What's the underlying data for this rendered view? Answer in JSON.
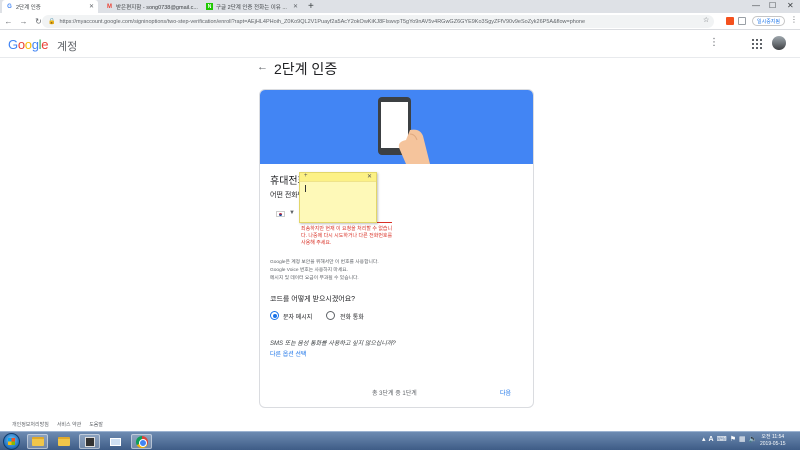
{
  "browser": {
    "tabs": [
      {
        "title": "2단계 인증",
        "favicon": "google-g",
        "active": true
      },
      {
        "title": "받은편지함 - song0738@gmail.c...",
        "favicon": "gmail-m",
        "active": false
      },
      {
        "title": "구글 2단계 인증 전화는 이유 ...",
        "favicon": "green-square",
        "active": false
      }
    ],
    "url": "https://myaccount.google.com/signinoptions/two-step-verification/enroll?rapt=AEjHL4PHoih_Z0Ko9QL2V1Puayf2a5AcY2okOwKiKJ8FIswvpT5gYo9nAV5v4RGwGZ6GYE9Ko3SgyZFfV90v9eSoZyk26P5A&flow=phone",
    "paused_label": "일시중지됨"
  },
  "header": {
    "logo": "Google",
    "account_label": "계정"
  },
  "page": {
    "title": "2단계 인증"
  },
  "card": {
    "title": "휴대전화",
    "subtitle": "어떤 전화번",
    "error": "죄송하지만 현재 이 요청을 처리할 수 없습니다. 나중에 다시 시도하거나 다른 전화번호를 사용해 주세요.",
    "info_lines": [
      "Google은 계정 보안을 위해서만 이 번호를 사용합니다.",
      "Google Voice 번호는 사용하지 마세요.",
      "메시지 및 데이터 요금이 부과될 수 있습니다."
    ],
    "question": "코드를 어떻게 받으시겠어요?",
    "options": [
      {
        "label": "문자 메시지",
        "selected": true
      },
      {
        "label": "전화 통화",
        "selected": false
      }
    ],
    "sms_question": "SMS 또는 음성 통화를 사용하고 싶지 않으십니까?",
    "other_option_link": "다른 옵션 선택",
    "step_text": "총 3단계 중 1단계",
    "next_label": "다음"
  },
  "footer": {
    "links": [
      "개인정보처리방침",
      "서비스 약관",
      "도움말"
    ]
  },
  "taskbar": {
    "tray_letter": "A",
    "time": "오전 11:54",
    "date": "2019-05-15"
  }
}
